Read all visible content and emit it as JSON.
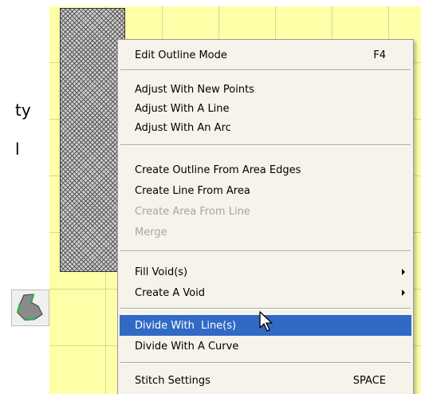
{
  "doc": {
    "text_fragments": [
      "ty",
      "l"
    ]
  },
  "icons": {
    "tool_icon": "area-shape-tool-icon",
    "cursor": "arrow-pointer-cursor"
  },
  "menu": {
    "items": [
      {
        "label": "Edit Outline Mode",
        "shortcut": "F4"
      },
      {
        "label": "Adjust With New Points"
      },
      {
        "label": "Adjust With A Line"
      },
      {
        "label": "Adjust With An Arc"
      },
      {
        "label": "Create Outline From Area Edges"
      },
      {
        "label": "Create Line From Area"
      },
      {
        "label": "Create Area From Line",
        "disabled": true
      },
      {
        "label": "Merge",
        "disabled": true
      },
      {
        "label": "Fill Void(s)",
        "submenu": true
      },
      {
        "label": "Create A Void",
        "submenu": true
      },
      {
        "label": "Divide With  Line(s)",
        "selected": true
      },
      {
        "label": "Divide With A Curve"
      },
      {
        "label": "Stitch Settings",
        "shortcut": "SPACE"
      }
    ]
  },
  "colors": {
    "canvas_bg": "#ffffa8",
    "menu_bg": "#f5f3ea",
    "selection": "#316ac5",
    "disabled_text": "#a7a6a0"
  }
}
